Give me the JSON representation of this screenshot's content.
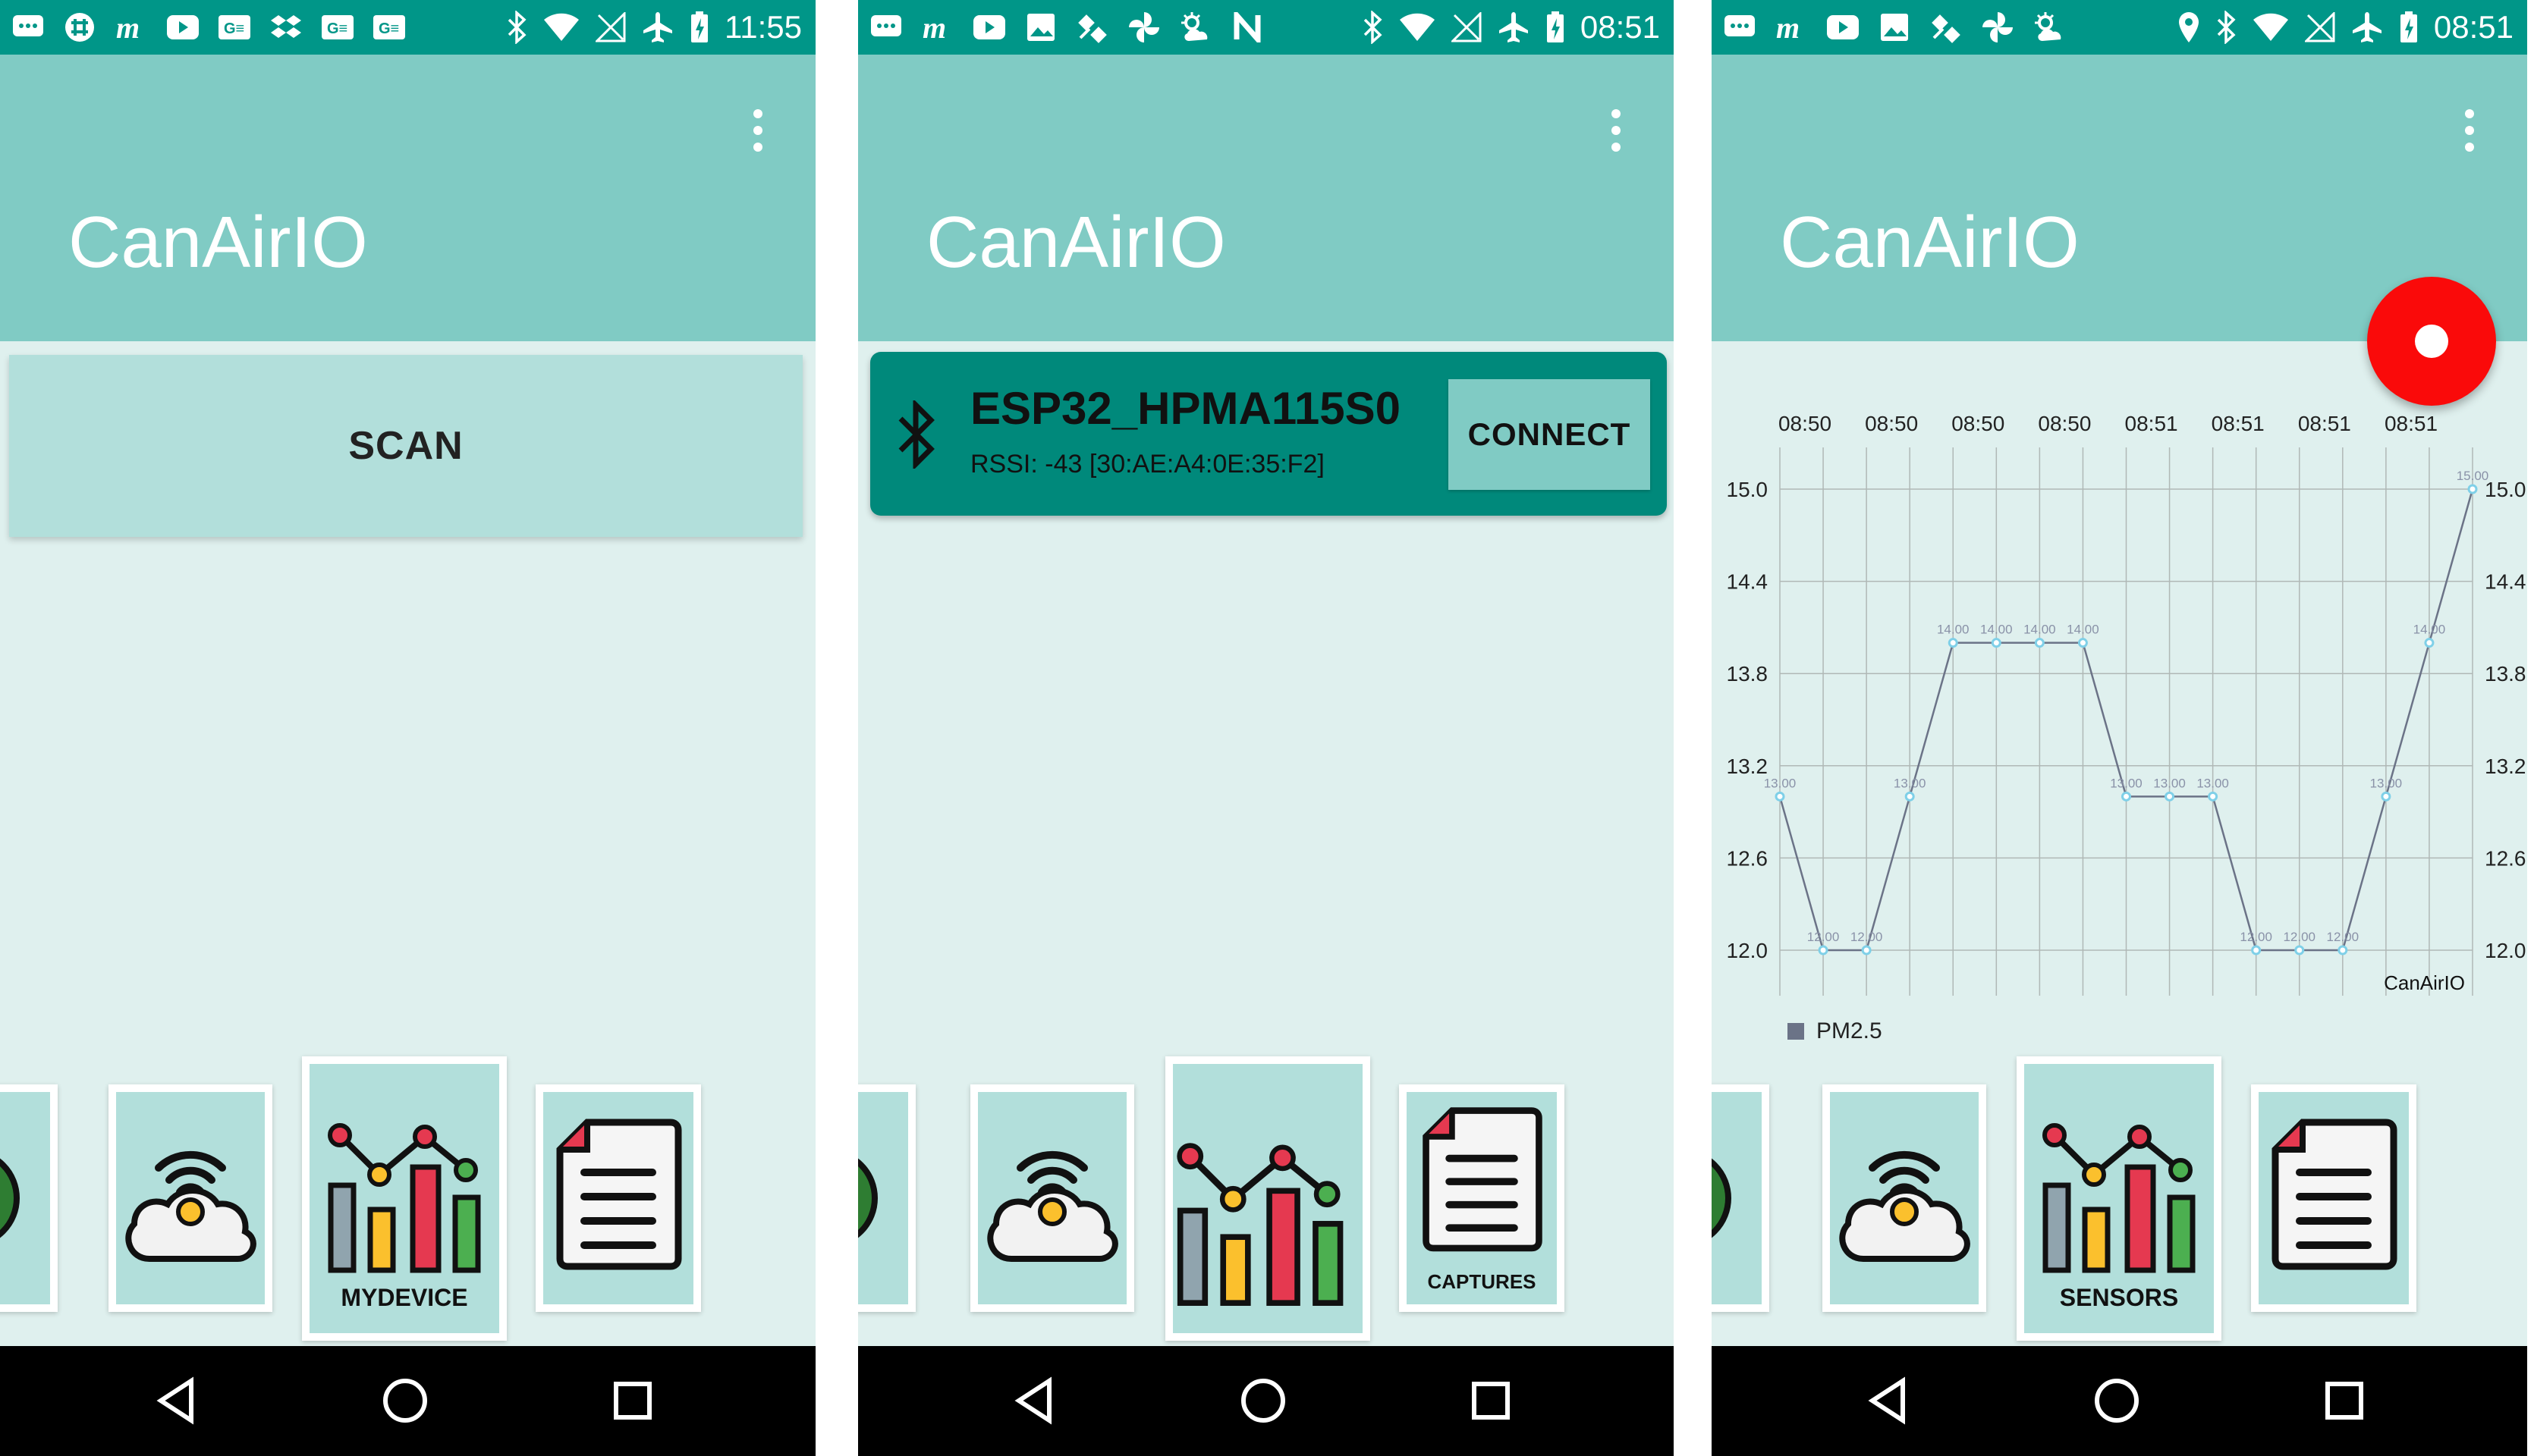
{
  "app_title": "CanAirIO",
  "screens": [
    {
      "status": {
        "time": "11:55"
      },
      "scan_label": "SCAN",
      "cards": [
        {
          "label": ""
        },
        {
          "label": ""
        },
        {
          "label": "MYDEVICE"
        },
        {
          "label": ""
        }
      ]
    },
    {
      "status": {
        "time": "08:51"
      },
      "device": {
        "name": "ESP32_HPMA115S0",
        "info": "RSSI: -43 [30:AE:A4:0E:35:F2]",
        "connect_label": "CONNECT"
      },
      "cards": [
        {
          "label": ""
        },
        {
          "label": ""
        },
        {
          "label": ""
        },
        {
          "label": "CAPTURES"
        }
      ]
    },
    {
      "status": {
        "time": "08:51"
      },
      "cards": [
        {
          "label": ""
        },
        {
          "label": ""
        },
        {
          "label": "SENSORS"
        },
        {
          "label": ""
        }
      ]
    }
  ],
  "chart_data": {
    "type": "line",
    "x": [
      "08:50",
      "08:50",
      "08:50",
      "08:50",
      "08:50",
      "08:50",
      "08:50",
      "08:50",
      "08:51",
      "08:51",
      "08:51",
      "08:51",
      "08:51",
      "08:51",
      "08:51",
      "08:51"
    ],
    "x_tick_labels": [
      "08:50",
      "08:50",
      "08:50",
      "08:50",
      "08:51",
      "08:51",
      "08:51",
      "08:51"
    ],
    "series": [
      {
        "name": "PM2.5",
        "values": [
          13,
          12,
          12,
          13,
          14,
          14,
          14,
          14,
          13,
          13,
          13,
          12,
          12,
          12,
          13,
          14,
          15
        ],
        "point_labels": [
          "13.00",
          "12.00",
          "12.00",
          "13.00",
          "14.00",
          "14.00",
          "14.00",
          "14.00",
          "13.00",
          "13.00",
          "13.00",
          "12.00",
          "12.00",
          "12.00",
          "13.00",
          "14.00",
          "15.00"
        ]
      }
    ],
    "y_ticks": [
      "12.0",
      "12.6",
      "13.2",
      "13.8",
      "14.4",
      "15.0"
    ],
    "ylim": [
      12.0,
      15.0
    ],
    "description_label": "CanAirIO",
    "grid": true,
    "legend_position": "bottom-left",
    "colors": {
      "line": "#6b7387",
      "point": "#7fd0e8",
      "grid": "#b0b8b6"
    }
  },
  "colors": {
    "statusbar": "#009688",
    "appbar": "#80cbc4",
    "background": "#dff0ee",
    "card": "#b2dfdb",
    "device_card": "#00897b",
    "fab": "#fa0a0a"
  },
  "icons": {
    "status_left_1": [
      "message-icon",
      "slack-icon",
      "m-icon",
      "youtube-icon",
      "ge-icon",
      "dropbox-icon",
      "ge-icon",
      "ge-icon"
    ],
    "status_left_2": [
      "message-icon",
      "m-icon",
      "youtube-icon",
      "image-icon",
      "satellite-icon",
      "pinwheel-icon",
      "weather-icon",
      "n-icon"
    ],
    "status_left_3": [
      "message-icon",
      "m-icon",
      "youtube-icon",
      "image-icon",
      "satellite-icon",
      "pinwheel-icon",
      "weather-icon"
    ],
    "cards": [
      "globe-icon",
      "cloud-wireless-icon",
      "chart-icon",
      "document-icon"
    ]
  }
}
